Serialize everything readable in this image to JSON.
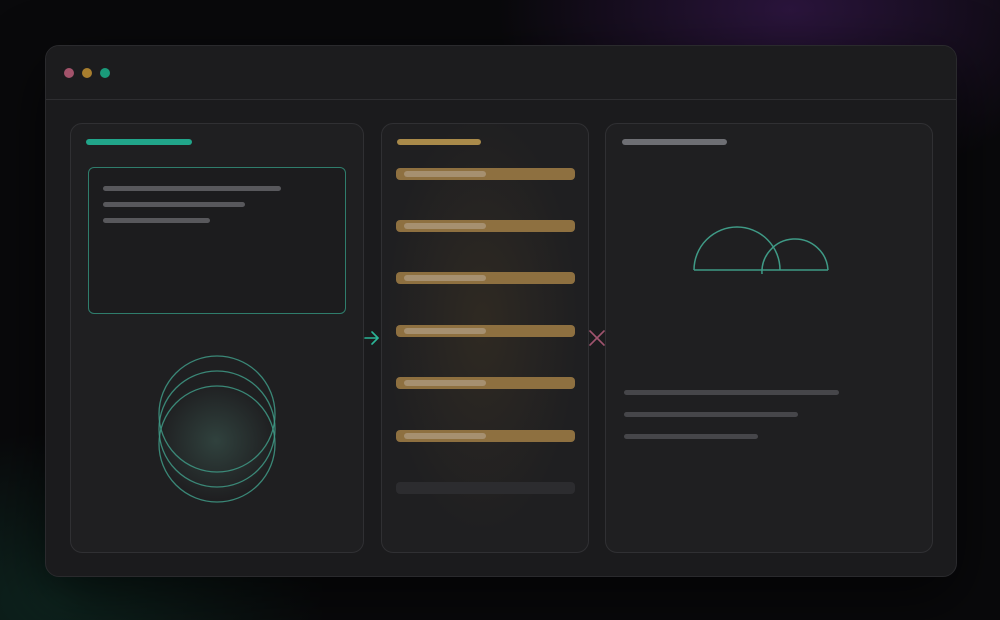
{
  "window": {
    "traffic_lights": [
      {
        "name": "close",
        "color": "#a3536b"
      },
      {
        "name": "minimize",
        "color": "#a87e2e"
      },
      {
        "name": "maximize",
        "color": "#1a9a7a"
      }
    ]
  },
  "colors": {
    "teal": "#22a58a",
    "teal_stroke": "#3f9a86",
    "gold": "#8e7040",
    "gold_header": "#a98a4a",
    "gray_header": "#6e6f74",
    "text_line": "#4a4a4e",
    "arrow": "#2bb597",
    "cross": "#a0546f"
  },
  "left_panel": {
    "header_color": "#21a58a",
    "card_lines": 3,
    "rings": 3
  },
  "middle_panel": {
    "header_color": "#a98a4a",
    "active_items": 6,
    "placeholder_items": 1
  },
  "right_panel": {
    "header_color": "#6e6f74",
    "text_lines": 3,
    "arcs": 2
  },
  "connectors": {
    "left_to_middle": "arrow-right-icon",
    "middle_to_right": "close-icon"
  }
}
